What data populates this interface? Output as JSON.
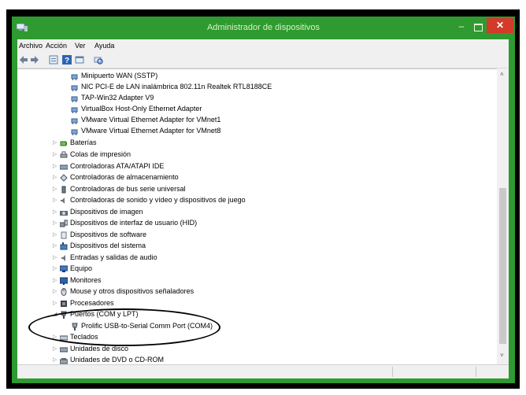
{
  "window": {
    "title": "Administrador de dispositivos",
    "titlebar_color": "#2e9a2f",
    "close_color": "#d33a2a"
  },
  "menu": [
    "Archivo",
    "Acción",
    "Ver",
    "Ayuda"
  ],
  "toolbar": [
    "back-icon",
    "forward-icon",
    "properties-icon",
    "help-icon",
    "view-icon",
    "scan-hardware-icon"
  ],
  "tree": {
    "children": [
      "Minipuerto WAN (SSTP)",
      "NIC PCI-E de LAN inalámbrica 802.11n Realtek RTL8188CE",
      "TAP-Win32 Adapter V9",
      "VirtualBox Host-Only Ethernet Adapter",
      "VMware Virtual Ethernet Adapter for VMnet1",
      "VMware Virtual Ethernet Adapter for VMnet8"
    ],
    "categories": [
      "Baterías",
      "Colas de impresión",
      "Controladoras ATA/ATAPI IDE",
      "Controladoras de almacenamiento",
      "Controladoras de bus serie universal",
      "Controladoras de sonido y vídeo y dispositivos de juego",
      "Dispositivos de imagen",
      "Dispositivos de interfaz de usuario (HID)",
      "Dispositivos de software",
      "Dispositivos del sistema",
      "Entradas y salidas de audio",
      "Equipo",
      "Monitores",
      "Mouse y otros dispositivos señaladores",
      "Procesadores"
    ],
    "ports_category": "Puertos (COM y LPT)",
    "ports_child": "Prolific USB-to-Serial Comm Port (COM4)",
    "after": [
      "Teclados",
      "Unidades de disco",
      "Unidades de DVD o CD-ROM"
    ]
  }
}
